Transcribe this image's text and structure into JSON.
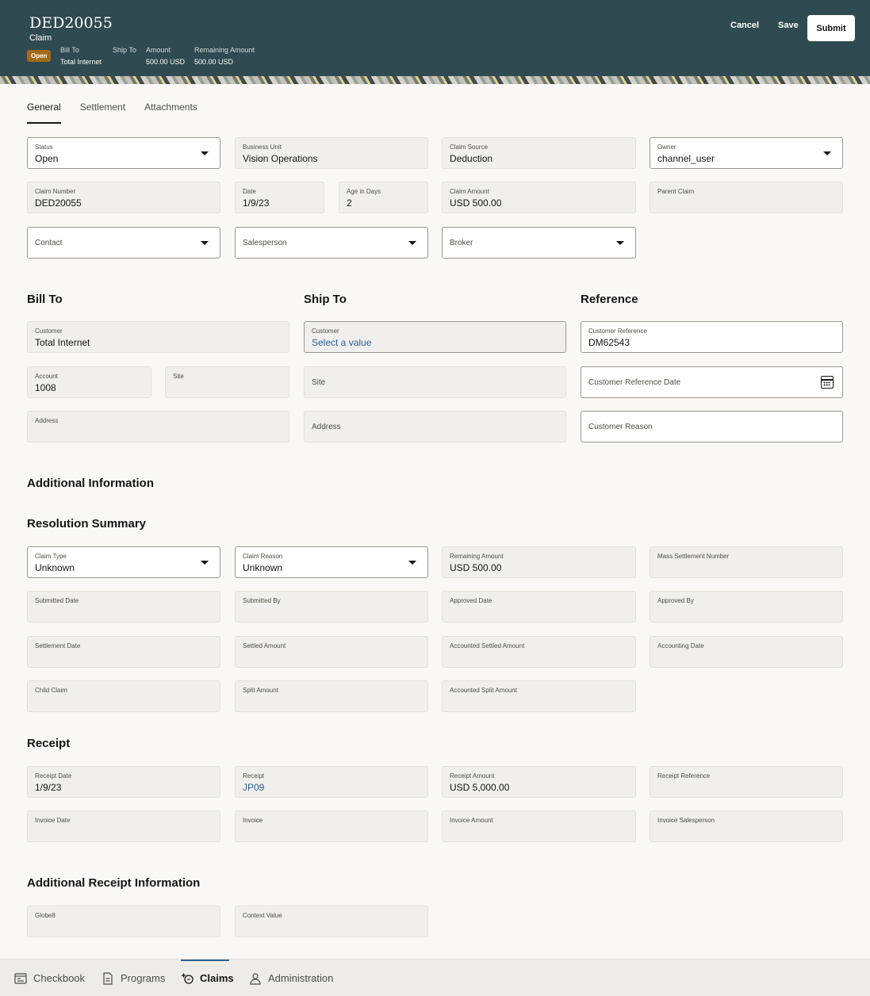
{
  "header": {
    "title": "DED20055",
    "subtitle": "Claim",
    "status_badge": "Open",
    "fields": [
      {
        "label": "Bill To",
        "value": "Total Internet"
      },
      {
        "label": "Ship To",
        "value": ""
      },
      {
        "label": "Amount",
        "value": "500.00 USD"
      },
      {
        "label": "Remaining Amount",
        "value": "500.00 USD"
      }
    ],
    "cancel_label": "Cancel",
    "save_label": "Save",
    "submit_label": "Submit"
  },
  "tabs": [
    "General",
    "Settlement",
    "Attachments"
  ],
  "general": {
    "status": {
      "label": "Status",
      "value": "Open"
    },
    "business_unit": {
      "label": "Business Unit",
      "value": "Vision Operations"
    },
    "claim_source": {
      "label": "Claim Source",
      "value": "Deduction"
    },
    "owner": {
      "label": "Owner",
      "value": "channel_user"
    },
    "claim_number": {
      "label": "Claim Number",
      "value": "DED20055"
    },
    "date": {
      "label": "Date",
      "value": "1/9/23"
    },
    "age_in_days": {
      "label": "Age in Days",
      "value": "2"
    },
    "claim_amount": {
      "label": "Claim Amount",
      "value": "USD 500.00"
    },
    "parent_claim": {
      "label": "Parent Claim",
      "value": ""
    },
    "contact": {
      "placeholder": "Contact"
    },
    "salesperson": {
      "placeholder": "Salesperson"
    },
    "broker": {
      "placeholder": "Broker"
    }
  },
  "bill_to": {
    "heading": "Bill To",
    "customer": {
      "label": "Customer",
      "value": "Total Internet"
    },
    "account": {
      "label": "Account",
      "value": "1008"
    },
    "site": {
      "label": "Site",
      "value": ""
    },
    "address": {
      "label": "Address",
      "value": ""
    }
  },
  "ship_to": {
    "heading": "Ship To",
    "customer": {
      "label": "Customer",
      "value": "Select a value"
    },
    "site_placeholder": "Site",
    "address_placeholder": "Address"
  },
  "reference": {
    "heading": "Reference",
    "customer_reference": {
      "label": "Customer Reference",
      "value": "DM62543"
    },
    "customer_reference_date_placeholder": "Customer Reference Date",
    "customer_reason_placeholder": "Customer Reason"
  },
  "additional_information": {
    "heading": "Additional Information"
  },
  "resolution_summary": {
    "heading": "Resolution Summary",
    "claim_type": {
      "label": "Claim Type",
      "value": "Unknown"
    },
    "claim_reason": {
      "label": "Claim Reason",
      "value": "Unknown"
    },
    "remaining_amount": {
      "label": "Remaining Amount",
      "value": "USD 500.00"
    },
    "mass_settlement_number": {
      "label": "Mass Settlement Number",
      "value": ""
    },
    "submitted_date": {
      "label": "Submitted Date",
      "value": ""
    },
    "submitted_by": {
      "label": "Submitted By",
      "value": ""
    },
    "approved_date": {
      "label": "Approved Date",
      "value": ""
    },
    "approved_by": {
      "label": "Approved By",
      "value": ""
    },
    "settlement_date": {
      "label": "Settlement Date",
      "value": ""
    },
    "settled_amount": {
      "label": "Settled Amount",
      "value": ""
    },
    "accounted_settled_amount": {
      "label": "Accounted Settled Amount",
      "value": ""
    },
    "accounting_date": {
      "label": "Accounting Date",
      "value": ""
    },
    "child_claim": {
      "label": "Child Claim",
      "value": ""
    },
    "split_amount": {
      "label": "Split Amount",
      "value": ""
    },
    "accounted_split_amount": {
      "label": "Accounted Split Amount",
      "value": ""
    }
  },
  "receipt": {
    "heading": "Receipt",
    "receipt_date": {
      "label": "Receipt Date",
      "value": "1/9/23"
    },
    "receipt": {
      "label": "Receipt",
      "value": "JP09"
    },
    "receipt_amount": {
      "label": "Receipt Amount",
      "value": "USD 5,000.00"
    },
    "receipt_reference": {
      "label": "Receipt Reference",
      "value": ""
    },
    "invoice_date": {
      "label": "Invoice Date",
      "value": ""
    },
    "invoice": {
      "label": "Invoice",
      "value": ""
    },
    "invoice_amount": {
      "label": "Invoice Amount",
      "value": ""
    },
    "invoice_salesperson": {
      "label": "Invoice Salesperson",
      "value": ""
    }
  },
  "additional_receipt_information": {
    "heading": "Additional Receipt Information",
    "globe8": {
      "label": "Globe8",
      "value": ""
    },
    "context_value": {
      "label": "Context Value",
      "value": ""
    }
  },
  "footer_nav": [
    {
      "label": "Checkbook",
      "icon": "checkbook-icon"
    },
    {
      "label": "Programs",
      "icon": "programs-icon"
    },
    {
      "label": "Claims",
      "icon": "claims-icon"
    },
    {
      "label": "Administration",
      "icon": "administration-icon"
    }
  ]
}
